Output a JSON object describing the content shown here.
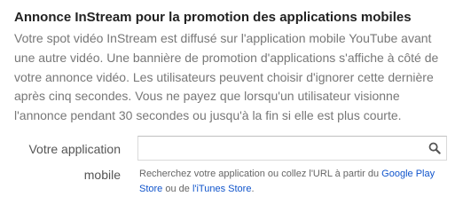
{
  "section": {
    "title": "Annonce InStream pour la promotion des applications mobiles",
    "description": "Votre spot vidéo InStream est diffusé sur l'application mobile YouTube avant une autre vidéo. Une bannière de promotion d'applications s'affiche à côté de votre annonce vidéo. Les utilisateurs peuvent choisir d'ignorer cette dernière après cinq secondes. Vous ne payez que lorsqu'un utilisateur visionne l'annonce pendant 30 secondes ou jusqu'à la fin si elle est plus courte."
  },
  "app_field": {
    "label_line1": "Votre application",
    "label_line2": "mobile",
    "value": "",
    "search_icon": "search-icon",
    "help_prefix": "Recherchez votre application ou collez l'URL à partir du ",
    "help_link_google_play": "Google Play Store",
    "help_middle": " ou de ",
    "help_link_itunes": "l'iTunes Store",
    "help_suffix": "."
  },
  "colors": {
    "link": "#1155cc",
    "title": "#222222",
    "body_text": "#777777",
    "input_border": "#d9d9d9"
  }
}
